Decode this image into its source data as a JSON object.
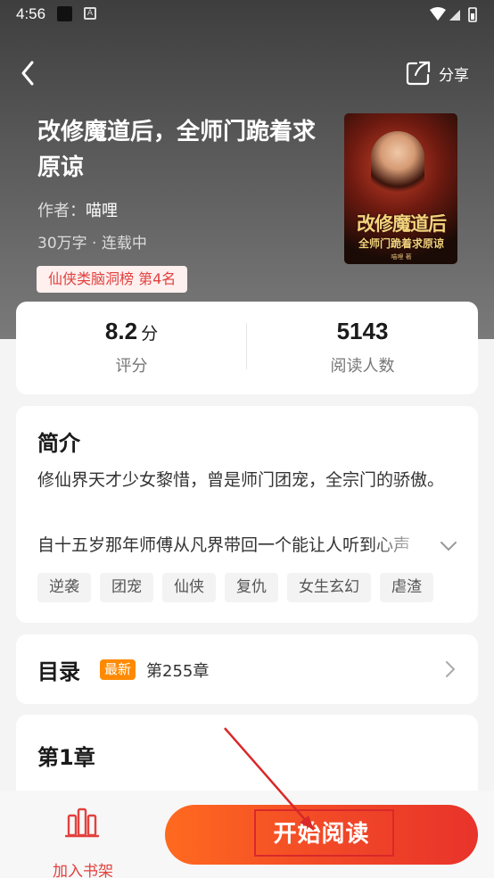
{
  "status_bar": {
    "time": "4:56"
  },
  "header": {
    "share_label": "分享"
  },
  "book": {
    "title": "改修魔道后，全师门跪着求原谅",
    "author_prefix": "作者：",
    "author_name": "喵哩",
    "meta": "30万字 · 连载中",
    "rank": "仙侠类脑洞榜 第4名",
    "cover_title": "改修魔道后",
    "cover_subtitle": "全师门跪着求原谅",
    "cover_author": "喵哩 著"
  },
  "stats": {
    "rating_value": "8.2",
    "rating_unit": "分",
    "rating_label": "评分",
    "readers_value": "5143",
    "readers_label": "阅读人数"
  },
  "intro": {
    "title": "简介",
    "text_line1": "修仙界天才少女黎惜，曾是师门团宠，全宗门的骄傲。",
    "text_line2": "自十五岁那年师傅从凡界带回一个能让人听到心声",
    "tags": [
      "逆袭",
      "团宠",
      "仙侠",
      "复仇",
      "女生玄幻",
      "虐渣"
    ]
  },
  "toc": {
    "title": "目录",
    "new_badge": "最新",
    "latest_chapter": "第255章"
  },
  "chapter": {
    "title": "第1章"
  },
  "bottom": {
    "shelf_label": "加入书架",
    "read_label": "开始阅读"
  },
  "colors": {
    "accent": "#e2413e",
    "button_start": "#ff6a1f",
    "button_end": "#e8332a",
    "badge_orange": "#ff8a00"
  }
}
